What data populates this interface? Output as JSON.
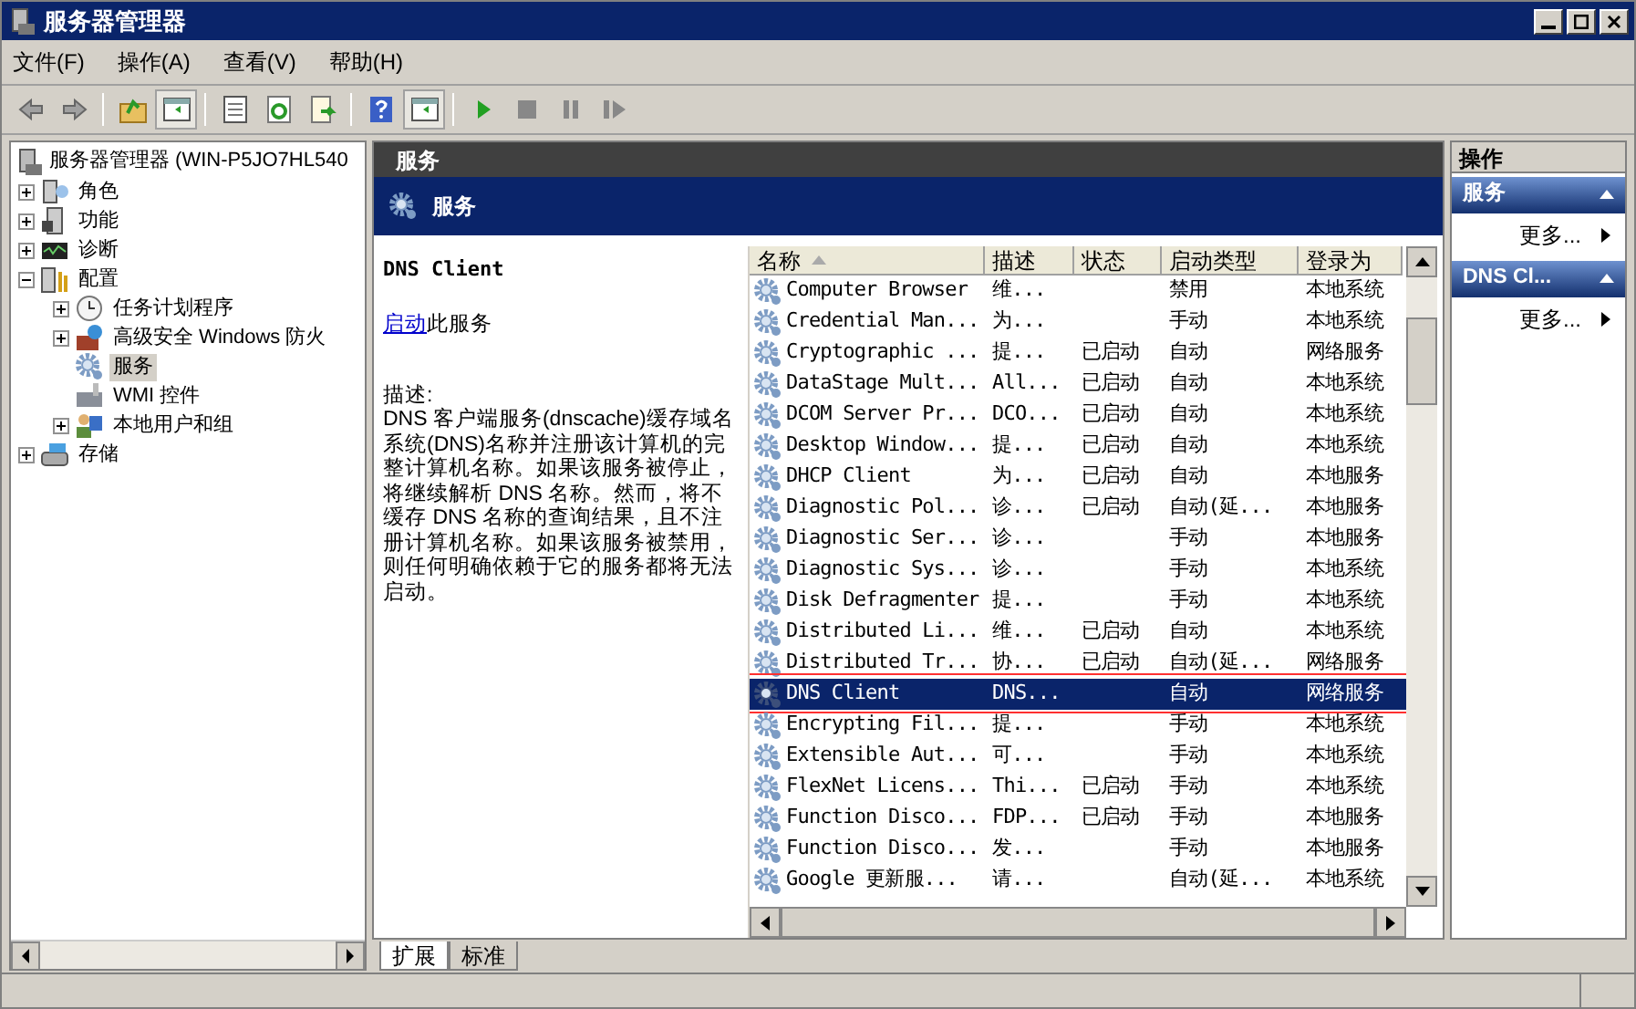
{
  "window": {
    "title": "服务器管理器"
  },
  "menu": [
    "文件(F)",
    "操作(A)",
    "查看(V)",
    "帮助(H)"
  ],
  "toolbar": [
    {
      "kind": "back"
    },
    {
      "kind": "forward"
    },
    {
      "kind": "sep"
    },
    {
      "kind": "up"
    },
    {
      "kind": "pane",
      "selected": true
    },
    {
      "kind": "sep"
    },
    {
      "kind": "props"
    },
    {
      "kind": "refresh"
    },
    {
      "kind": "export"
    },
    {
      "kind": "sep"
    },
    {
      "kind": "help"
    },
    {
      "kind": "pane",
      "selected": true
    },
    {
      "kind": "sep"
    },
    {
      "kind": "play"
    },
    {
      "kind": "stop"
    },
    {
      "kind": "pause"
    },
    {
      "kind": "resume"
    }
  ],
  "tree": {
    "label": "服务器管理器 (WIN-P5JO7HL540",
    "kind": "server",
    "children": [
      {
        "label": "角色",
        "kind": "roles",
        "expanded": false
      },
      {
        "label": "功能",
        "kind": "features",
        "expanded": false
      },
      {
        "label": "诊断",
        "kind": "diag",
        "expanded": false
      },
      {
        "label": "配置",
        "kind": "config",
        "expanded": true,
        "children": [
          {
            "label": "任务计划程序",
            "kind": "clock",
            "expanded": false
          },
          {
            "label": "高级安全 Windows 防火",
            "kind": "firewall",
            "expanded": false
          },
          {
            "label": "服务",
            "kind": "gear",
            "selected": true
          },
          {
            "label": "WMI 控件",
            "kind": "wmi"
          },
          {
            "label": "本地用户和组",
            "kind": "users",
            "expanded": false
          }
        ]
      },
      {
        "label": "存储",
        "kind": "storage",
        "expanded": false
      }
    ]
  },
  "center": {
    "header": "服务",
    "band_title": "服务",
    "detail": {
      "name": "DNS Client",
      "action_link": "启动",
      "action_rest": "此服务",
      "description_label": "描述:",
      "description": "DNS 客户端服务(dnscache)缓存域名系统(DNS)名称并注册该计算机的完整计算机名称。如果该服务被停止，将继续解析 DNS 名称。然而，将不缓存 DNS 名称的查询结果，且不注册计算机名称。如果该服务被禁用，则任何明确依赖于它的服务都将无法启动。"
    },
    "table": {
      "columns": [
        {
          "label": "名称",
          "sorted": true
        },
        {
          "label": "描述"
        },
        {
          "label": "状态"
        },
        {
          "label": "启动类型"
        },
        {
          "label": "登录为"
        }
      ],
      "rows": [
        {
          "cells": [
            "Computer Browser",
            "维...",
            "",
            "禁用",
            "本地系统"
          ],
          "selected": false
        },
        {
          "cells": [
            "Credential Man...",
            "为...",
            "",
            "手动",
            "本地系统"
          ],
          "selected": false
        },
        {
          "cells": [
            "Cryptographic ...",
            "提...",
            "已启动",
            "自动",
            "网络服务"
          ],
          "selected": false
        },
        {
          "cells": [
            "DataStage Mult...",
            "All...",
            "已启动",
            "自动",
            "本地系统"
          ],
          "selected": false
        },
        {
          "cells": [
            "DCOM Server Pr...",
            "DCO...",
            "已启动",
            "自动",
            "本地系统"
          ],
          "selected": false
        },
        {
          "cells": [
            "Desktop Window...",
            "提...",
            "已启动",
            "自动",
            "本地系统"
          ],
          "selected": false
        },
        {
          "cells": [
            "DHCP Client",
            "为...",
            "已启动",
            "自动",
            "本地服务"
          ],
          "selected": false
        },
        {
          "cells": [
            "Diagnostic Pol...",
            "诊...",
            "已启动",
            "自动(延...",
            "本地服务"
          ],
          "selected": false
        },
        {
          "cells": [
            "Diagnostic Ser...",
            "诊...",
            "",
            "手动",
            "本地服务"
          ],
          "selected": false
        },
        {
          "cells": [
            "Diagnostic Sys...",
            "诊...",
            "",
            "手动",
            "本地系统"
          ],
          "selected": false
        },
        {
          "cells": [
            "Disk Defragmenter",
            "提...",
            "",
            "手动",
            "本地系统"
          ],
          "selected": false
        },
        {
          "cells": [
            "Distributed Li...",
            "维...",
            "已启动",
            "自动",
            "本地系统"
          ],
          "selected": false
        },
        {
          "cells": [
            "Distributed Tr...",
            "协...",
            "已启动",
            "自动(延...",
            "网络服务"
          ],
          "selected": false
        },
        {
          "cells": [
            "DNS Client",
            "DNS...",
            "",
            "自动",
            "网络服务"
          ],
          "selected": true,
          "outlined": true
        },
        {
          "cells": [
            "Encrypting Fil...",
            "提...",
            "",
            "手动",
            "本地系统"
          ],
          "selected": false
        },
        {
          "cells": [
            "Extensible Aut...",
            "可...",
            "",
            "手动",
            "本地系统"
          ],
          "selected": false
        },
        {
          "cells": [
            "FlexNet Licens...",
            "Thi...",
            "已启动",
            "手动",
            "本地系统"
          ],
          "selected": false
        },
        {
          "cells": [
            "Function Disco...",
            "FDP...",
            "已启动",
            "手动",
            "本地服务"
          ],
          "selected": false
        },
        {
          "cells": [
            "Function Disco...",
            "发...",
            "",
            "手动",
            "本地服务"
          ],
          "selected": false
        },
        {
          "cells": [
            "Google 更新服...",
            "请...",
            "",
            "自动(延...",
            "本地系统"
          ],
          "selected": false
        }
      ]
    },
    "tabs": [
      {
        "label": "扩展",
        "selected": true
      },
      {
        "label": "标准",
        "selected": false
      }
    ]
  },
  "actions": {
    "title": "操作",
    "groups": [
      {
        "title": "服务",
        "expanded": true,
        "items": [
          "更多..."
        ]
      },
      {
        "title": "DNS Cl...",
        "expanded": true,
        "items": [
          "更多..."
        ]
      }
    ]
  }
}
